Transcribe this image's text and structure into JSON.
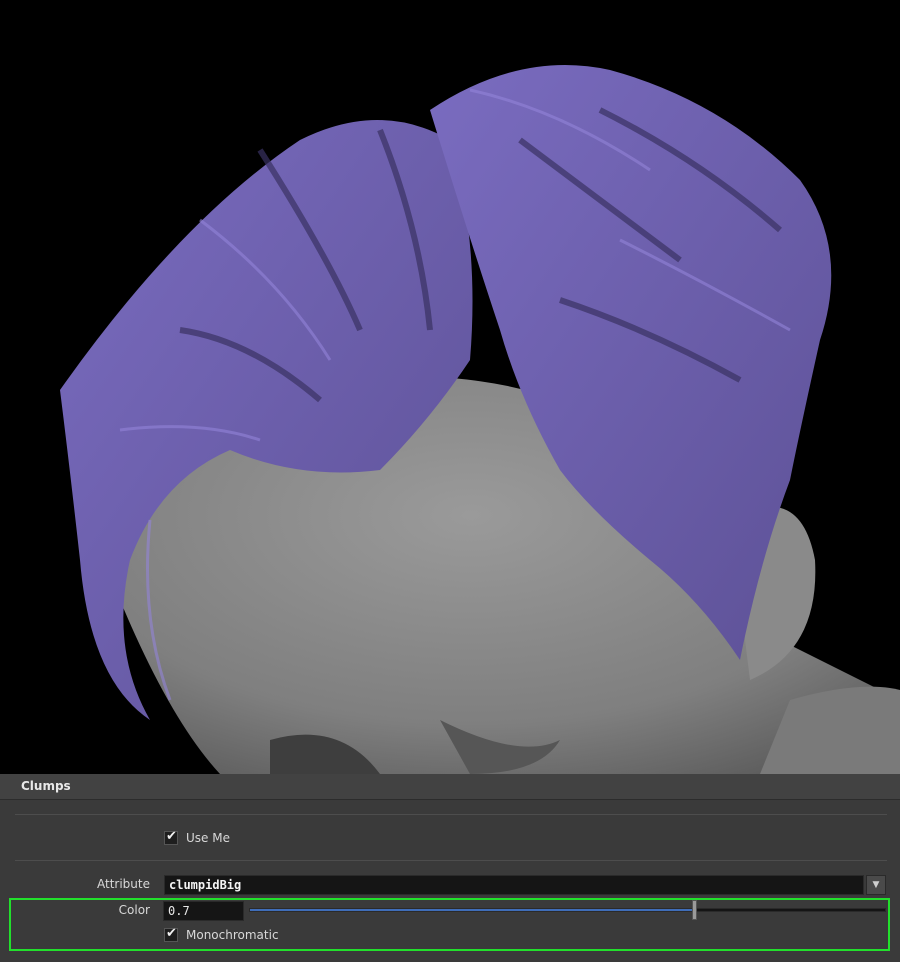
{
  "panel": {
    "title": "Clumps"
  },
  "use_me": {
    "label": "Use Me",
    "checked": true
  },
  "attribute": {
    "label": "Attribute",
    "value": "clumpidBig"
  },
  "color": {
    "label": "Color",
    "value": "0.7",
    "fraction": 0.7
  },
  "monochromatic": {
    "label": "Monochromatic",
    "checked": true
  },
  "icons": {
    "checkbox": "check-icon",
    "dropdown": "chevron-down-icon"
  },
  "colors": {
    "hair": "#6b5fa8",
    "skin": "#8c8c8c",
    "highlight": "#22e02c",
    "slider_fill": "#3f6db8"
  }
}
